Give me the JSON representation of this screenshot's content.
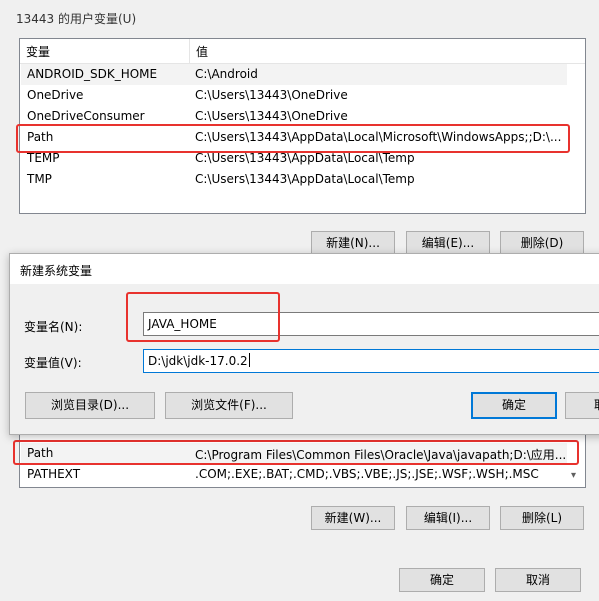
{
  "user_vars": {
    "group_title": "13443 的用户变量(U)",
    "col_var": "变量",
    "col_val": "值",
    "rows": [
      {
        "name": "ANDROID_SDK_HOME",
        "value": "C:\\Android"
      },
      {
        "name": "OneDrive",
        "value": "C:\\Users\\13443\\OneDrive"
      },
      {
        "name": "OneDriveConsumer",
        "value": "C:\\Users\\13443\\OneDrive"
      },
      {
        "name": "Path",
        "value": "C:\\Users\\13443\\AppData\\Local\\Microsoft\\WindowsApps;;D:\\..."
      },
      {
        "name": "TEMP",
        "value": "C:\\Users\\13443\\AppData\\Local\\Temp"
      },
      {
        "name": "TMP",
        "value": "C:\\Users\\13443\\AppData\\Local\\Temp"
      }
    ],
    "buttons": {
      "new": "新建(N)...",
      "edit": "编辑(E)...",
      "delete": "删除(D)"
    }
  },
  "dialog": {
    "title": "新建系统变量",
    "name_label": "变量名(N):",
    "name_value": "JAVA_HOME",
    "value_label": "变量值(V):",
    "value_value": "D:\\jdk\\jdk-17.0.2",
    "browse_dir": "浏览目录(D)...",
    "browse_file": "浏览文件(F)...",
    "ok": "确定",
    "cancel_partial": "取"
  },
  "system_vars": {
    "rows": [
      {
        "name": "Path",
        "value": "C:\\Program Files\\Common Files\\Oracle\\Java\\javapath;D:\\应用..."
      },
      {
        "name": "PATHEXT",
        "value": ".COM;.EXE;.BAT;.CMD;.VBS;.VBE;.JS;.JSE;.WSF;.WSH;.MSC"
      }
    ],
    "buttons": {
      "new": "新建(W)...",
      "edit": "编辑(I)...",
      "delete": "删除(L)"
    }
  },
  "footer": {
    "ok": "确定",
    "cancel": "取消"
  },
  "icons": {
    "scroll_down": "▾"
  }
}
